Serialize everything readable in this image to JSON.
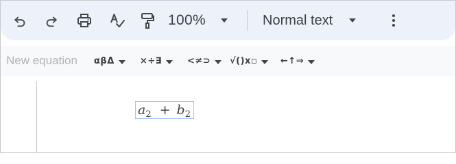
{
  "toolbar": {
    "undo_icon": "undo-icon",
    "redo_icon": "redo-icon",
    "print_icon": "print-icon",
    "spellcheck_icon": "spellcheck-icon",
    "paint_format_icon": "paint-format-icon",
    "zoom_value": "100%",
    "paragraph_style": "Normal text",
    "more_icon": "more-vert-icon"
  },
  "equation_toolbar": {
    "new_equation_label": "New equation",
    "menus": [
      {
        "symbols": "αβΔ",
        "name": "greek-letters"
      },
      {
        "symbols": "×÷∃",
        "name": "misc-operations"
      },
      {
        "symbols": "<≠⊃",
        "name": "relations"
      },
      {
        "symbols": "√()x▫",
        "name": "math-operations"
      },
      {
        "symbols": "←↑⇒",
        "name": "arrows"
      }
    ]
  },
  "document": {
    "equation": {
      "term1_base": "a",
      "term1_sub": "2",
      "operator": "+",
      "term2_base": "b",
      "term2_sub": "2"
    }
  },
  "colors": {
    "toolbar_bg": "#edf2fa",
    "icon": "#444746",
    "equation_border": "#a6c3ec",
    "placeholder_text": "#b1b5b9"
  }
}
